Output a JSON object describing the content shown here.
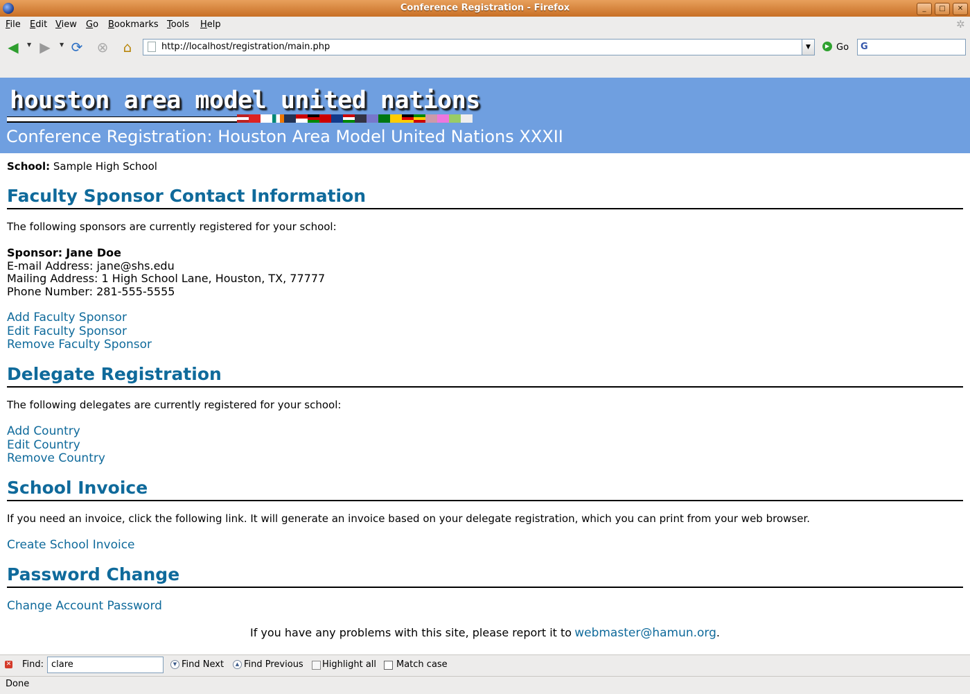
{
  "window": {
    "title": "Conference Registration - Firefox",
    "controls": {
      "minimize": "_",
      "maximize": "□",
      "close": "✕"
    }
  },
  "menubar": {
    "items": [
      {
        "label": "File",
        "accel": "F",
        "rest": "ile"
      },
      {
        "label": "Edit",
        "accel": "E",
        "rest": "dit"
      },
      {
        "label": "View",
        "accel": "V",
        "rest": "iew"
      },
      {
        "label": "Go",
        "accel": "G",
        "rest": "o"
      },
      {
        "label": "Bookmarks",
        "accel": "B",
        "rest": "ookmarks"
      },
      {
        "label": "Tools",
        "accel": "T",
        "rest": "ools"
      },
      {
        "label": "Help",
        "accel": "H",
        "rest": "elp"
      }
    ]
  },
  "navbar": {
    "url": "http://localhost/registration/main.php",
    "go_label": "Go",
    "search_value": ""
  },
  "page": {
    "logo_text": "houston area model united nations",
    "heading": "Conference Registration: Houston Area Model United Nations XXXII",
    "school_label": "School:",
    "school_value": "Sample High School",
    "sponsor_section": {
      "title": "Faculty Sponsor Contact Information",
      "intro": "The following sponsors are currently registered for your school:",
      "sponsor_label": "Sponsor:",
      "sponsor_name": "Jane Doe",
      "email_line": "E-mail Address: jane@shs.edu",
      "mail_line": "Mailing Address: 1 High School Lane, Houston, TX, 77777",
      "phone_line": "Phone Number: 281-555-5555",
      "links": [
        "Add Faculty Sponsor",
        "Edit Faculty Sponsor",
        "Remove Faculty Sponsor"
      ]
    },
    "delegate_section": {
      "title": "Delegate Registration",
      "intro": "The following delegates are currently registered for your school:",
      "links": [
        "Add Country",
        "Edit Country",
        "Remove Country"
      ]
    },
    "invoice_section": {
      "title": "School Invoice",
      "text": "If you need an invoice, click the following link. It will generate an invoice based on your delegate registration, which you can print from your web browser.",
      "link": "Create School Invoice"
    },
    "password_section": {
      "title": "Password Change",
      "link": "Change Account Password"
    },
    "footer": {
      "text": "If you have any problems with this site, please report it to",
      "email": "webmaster@hamun.org",
      "end": "."
    }
  },
  "findbar": {
    "label": "Find:",
    "value": "clare",
    "find_next": "Find Next",
    "find_previous": "Find Previous",
    "highlight_all": "Highlight all",
    "match_case": "Match case"
  },
  "status": {
    "text": "Done"
  },
  "colors": {
    "header_band": "#6f9fe0",
    "section_heading": "#0f6a9b",
    "link": "#0f6a9b",
    "titlebar": "#d27f35"
  }
}
